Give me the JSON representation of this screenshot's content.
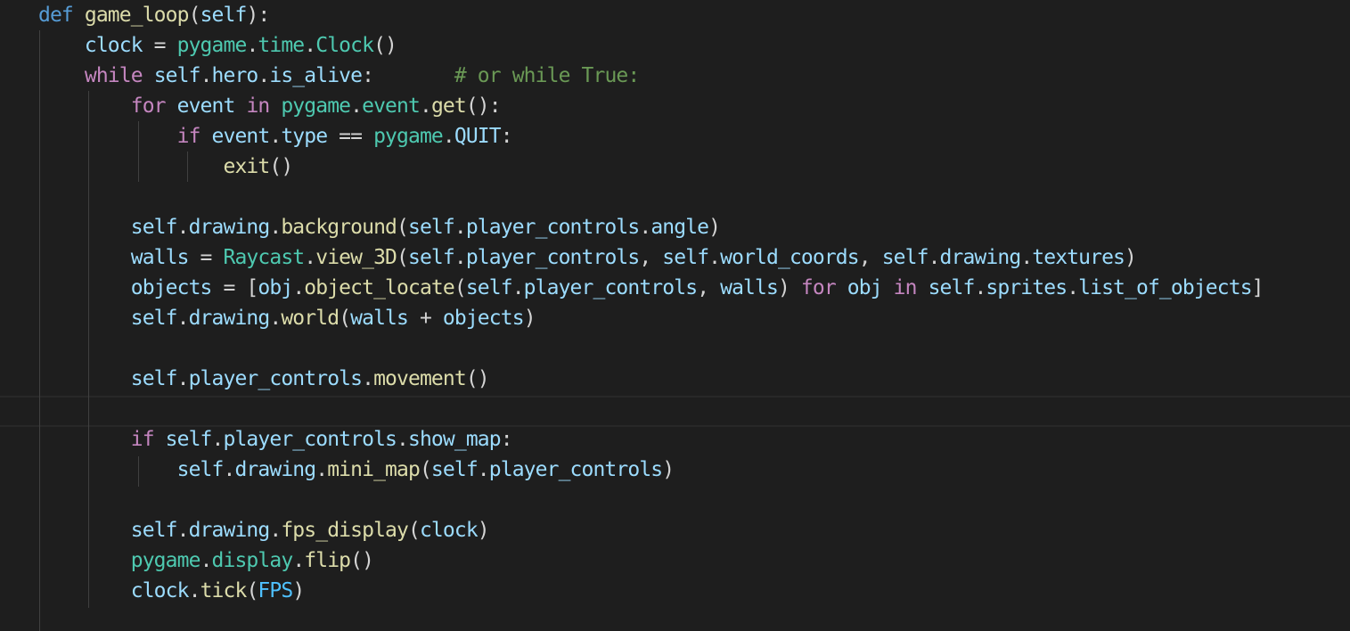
{
  "editor": {
    "language": "python",
    "theme_colors": {
      "background": "#1e1e1e",
      "keyword": "#569cd6",
      "control": "#c586c0",
      "function": "#dcdcaa",
      "variable": "#9cdcfe",
      "class": "#4ec9b0",
      "comment": "#6a9955",
      "text": "#d4d4d4"
    },
    "lines": [
      [
        {
          "t": "def",
          "c": "kw"
        },
        {
          "t": " ",
          "c": "plain"
        },
        {
          "t": "game_loop",
          "c": "fn"
        },
        {
          "t": "(",
          "c": "plain"
        },
        {
          "t": "self",
          "c": "var"
        },
        {
          "t": "):",
          "c": "plain"
        }
      ],
      [
        {
          "t": "    ",
          "c": "plain"
        },
        {
          "t": "clock",
          "c": "var"
        },
        {
          "t": " = ",
          "c": "plain"
        },
        {
          "t": "pygame",
          "c": "cls"
        },
        {
          "t": ".",
          "c": "plain"
        },
        {
          "t": "time",
          "c": "cls"
        },
        {
          "t": ".",
          "c": "plain"
        },
        {
          "t": "Clock",
          "c": "cls"
        },
        {
          "t": "()",
          "c": "plain"
        }
      ],
      [
        {
          "t": "    ",
          "c": "plain"
        },
        {
          "t": "while",
          "c": "ctl"
        },
        {
          "t": " ",
          "c": "plain"
        },
        {
          "t": "self",
          "c": "var"
        },
        {
          "t": ".",
          "c": "plain"
        },
        {
          "t": "hero",
          "c": "var"
        },
        {
          "t": ".",
          "c": "plain"
        },
        {
          "t": "is_alive",
          "c": "var"
        },
        {
          "t": ":       ",
          "c": "plain"
        },
        {
          "t": "# or while True:",
          "c": "cmt"
        }
      ],
      [
        {
          "t": "        ",
          "c": "plain"
        },
        {
          "t": "for",
          "c": "ctl"
        },
        {
          "t": " ",
          "c": "plain"
        },
        {
          "t": "event",
          "c": "var"
        },
        {
          "t": " ",
          "c": "plain"
        },
        {
          "t": "in",
          "c": "ctl"
        },
        {
          "t": " ",
          "c": "plain"
        },
        {
          "t": "pygame",
          "c": "cls"
        },
        {
          "t": ".",
          "c": "plain"
        },
        {
          "t": "event",
          "c": "cls"
        },
        {
          "t": ".",
          "c": "plain"
        },
        {
          "t": "get",
          "c": "fn"
        },
        {
          "t": "():",
          "c": "plain"
        }
      ],
      [
        {
          "t": "            ",
          "c": "plain"
        },
        {
          "t": "if",
          "c": "ctl"
        },
        {
          "t": " ",
          "c": "plain"
        },
        {
          "t": "event",
          "c": "var"
        },
        {
          "t": ".",
          "c": "plain"
        },
        {
          "t": "type",
          "c": "var"
        },
        {
          "t": " == ",
          "c": "plain"
        },
        {
          "t": "pygame",
          "c": "cls"
        },
        {
          "t": ".",
          "c": "plain"
        },
        {
          "t": "QUIT",
          "c": "var"
        },
        {
          "t": ":",
          "c": "plain"
        }
      ],
      [
        {
          "t": "                ",
          "c": "plain"
        },
        {
          "t": "exit",
          "c": "fn"
        },
        {
          "t": "()",
          "c": "plain"
        }
      ],
      [],
      [
        {
          "t": "        ",
          "c": "plain"
        },
        {
          "t": "self",
          "c": "var"
        },
        {
          "t": ".",
          "c": "plain"
        },
        {
          "t": "drawing",
          "c": "var"
        },
        {
          "t": ".",
          "c": "plain"
        },
        {
          "t": "background",
          "c": "fn"
        },
        {
          "t": "(",
          "c": "plain"
        },
        {
          "t": "self",
          "c": "var"
        },
        {
          "t": ".",
          "c": "plain"
        },
        {
          "t": "player_controls",
          "c": "var"
        },
        {
          "t": ".",
          "c": "plain"
        },
        {
          "t": "angle",
          "c": "var"
        },
        {
          "t": ")",
          "c": "plain"
        }
      ],
      [
        {
          "t": "        ",
          "c": "plain"
        },
        {
          "t": "walls",
          "c": "var"
        },
        {
          "t": " = ",
          "c": "plain"
        },
        {
          "t": "Raycast",
          "c": "cls"
        },
        {
          "t": ".",
          "c": "plain"
        },
        {
          "t": "view_3D",
          "c": "fn"
        },
        {
          "t": "(",
          "c": "plain"
        },
        {
          "t": "self",
          "c": "var"
        },
        {
          "t": ".",
          "c": "plain"
        },
        {
          "t": "player_controls",
          "c": "var"
        },
        {
          "t": ", ",
          "c": "plain"
        },
        {
          "t": "self",
          "c": "var"
        },
        {
          "t": ".",
          "c": "plain"
        },
        {
          "t": "world_coords",
          "c": "var"
        },
        {
          "t": ", ",
          "c": "plain"
        },
        {
          "t": "self",
          "c": "var"
        },
        {
          "t": ".",
          "c": "plain"
        },
        {
          "t": "drawing",
          "c": "var"
        },
        {
          "t": ".",
          "c": "plain"
        },
        {
          "t": "textures",
          "c": "var"
        },
        {
          "t": ")",
          "c": "plain"
        }
      ],
      [
        {
          "t": "        ",
          "c": "plain"
        },
        {
          "t": "objects",
          "c": "var"
        },
        {
          "t": " = [",
          "c": "plain"
        },
        {
          "t": "obj",
          "c": "var"
        },
        {
          "t": ".",
          "c": "plain"
        },
        {
          "t": "object_locate",
          "c": "fn"
        },
        {
          "t": "(",
          "c": "plain"
        },
        {
          "t": "self",
          "c": "var"
        },
        {
          "t": ".",
          "c": "plain"
        },
        {
          "t": "player_controls",
          "c": "var"
        },
        {
          "t": ", ",
          "c": "plain"
        },
        {
          "t": "walls",
          "c": "var"
        },
        {
          "t": ") ",
          "c": "plain"
        },
        {
          "t": "for",
          "c": "ctl"
        },
        {
          "t": " ",
          "c": "plain"
        },
        {
          "t": "obj",
          "c": "var"
        },
        {
          "t": " ",
          "c": "plain"
        },
        {
          "t": "in",
          "c": "ctl"
        },
        {
          "t": " ",
          "c": "plain"
        },
        {
          "t": "self",
          "c": "var"
        },
        {
          "t": ".",
          "c": "plain"
        },
        {
          "t": "sprites",
          "c": "var"
        },
        {
          "t": ".",
          "c": "plain"
        },
        {
          "t": "list_of_objects",
          "c": "var"
        },
        {
          "t": "]",
          "c": "plain"
        }
      ],
      [
        {
          "t": "        ",
          "c": "plain"
        },
        {
          "t": "self",
          "c": "var"
        },
        {
          "t": ".",
          "c": "plain"
        },
        {
          "t": "drawing",
          "c": "var"
        },
        {
          "t": ".",
          "c": "plain"
        },
        {
          "t": "world",
          "c": "fn"
        },
        {
          "t": "(",
          "c": "plain"
        },
        {
          "t": "walls",
          "c": "var"
        },
        {
          "t": " + ",
          "c": "plain"
        },
        {
          "t": "objects",
          "c": "var"
        },
        {
          "t": ")",
          "c": "plain"
        }
      ],
      [],
      [
        {
          "t": "        ",
          "c": "plain"
        },
        {
          "t": "self",
          "c": "var"
        },
        {
          "t": ".",
          "c": "plain"
        },
        {
          "t": "player_controls",
          "c": "var"
        },
        {
          "t": ".",
          "c": "plain"
        },
        {
          "t": "movement",
          "c": "fn"
        },
        {
          "t": "()",
          "c": "plain"
        }
      ],
      [],
      [
        {
          "t": "        ",
          "c": "plain"
        },
        {
          "t": "if",
          "c": "ctl"
        },
        {
          "t": " ",
          "c": "plain"
        },
        {
          "t": "self",
          "c": "var"
        },
        {
          "t": ".",
          "c": "plain"
        },
        {
          "t": "player_controls",
          "c": "var"
        },
        {
          "t": ".",
          "c": "plain"
        },
        {
          "t": "show_map",
          "c": "var"
        },
        {
          "t": ":",
          "c": "plain"
        }
      ],
      [
        {
          "t": "            ",
          "c": "plain"
        },
        {
          "t": "self",
          "c": "var"
        },
        {
          "t": ".",
          "c": "plain"
        },
        {
          "t": "drawing",
          "c": "var"
        },
        {
          "t": ".",
          "c": "plain"
        },
        {
          "t": "mini_map",
          "c": "fn"
        },
        {
          "t": "(",
          "c": "plain"
        },
        {
          "t": "self",
          "c": "var"
        },
        {
          "t": ".",
          "c": "plain"
        },
        {
          "t": "player_controls",
          "c": "var"
        },
        {
          "t": ")",
          "c": "plain"
        }
      ],
      [],
      [
        {
          "t": "        ",
          "c": "plain"
        },
        {
          "t": "self",
          "c": "var"
        },
        {
          "t": ".",
          "c": "plain"
        },
        {
          "t": "drawing",
          "c": "var"
        },
        {
          "t": ".",
          "c": "plain"
        },
        {
          "t": "fps_display",
          "c": "fn"
        },
        {
          "t": "(",
          "c": "plain"
        },
        {
          "t": "clock",
          "c": "var"
        },
        {
          "t": ")",
          "c": "plain"
        }
      ],
      [
        {
          "t": "        ",
          "c": "plain"
        },
        {
          "t": "pygame",
          "c": "cls"
        },
        {
          "t": ".",
          "c": "plain"
        },
        {
          "t": "display",
          "c": "cls"
        },
        {
          "t": ".",
          "c": "plain"
        },
        {
          "t": "flip",
          "c": "fn"
        },
        {
          "t": "()",
          "c": "plain"
        }
      ],
      [
        {
          "t": "        ",
          "c": "plain"
        },
        {
          "t": "clock",
          "c": "var"
        },
        {
          "t": ".",
          "c": "plain"
        },
        {
          "t": "tick",
          "c": "fn"
        },
        {
          "t": "(",
          "c": "plain"
        },
        {
          "t": "FPS",
          "c": "const"
        },
        {
          "t": ")",
          "c": "plain"
        }
      ]
    ]
  }
}
